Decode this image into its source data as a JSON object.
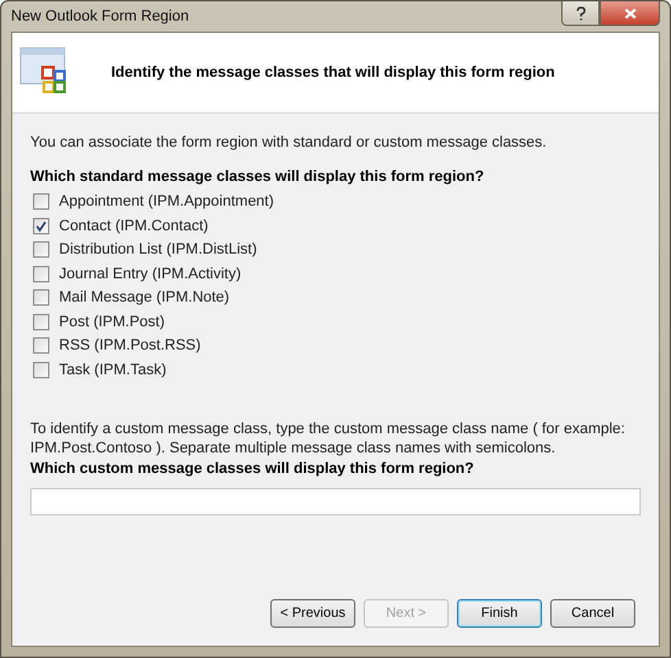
{
  "window": {
    "title": "New Outlook Form Region"
  },
  "header": {
    "title": "Identify the message classes that will display this form region"
  },
  "intro": "You can associate the form region with standard or custom message classes.",
  "standard": {
    "heading": "Which standard message classes will display this form region?",
    "options": [
      {
        "label": "Appointment (IPM.Appointment)",
        "checked": false
      },
      {
        "label": "Contact (IPM.Contact)",
        "checked": true
      },
      {
        "label": "Distribution List (IPM.DistList)",
        "checked": false
      },
      {
        "label": "Journal Entry (IPM.Activity)",
        "checked": false
      },
      {
        "label": "Mail Message (IPM.Note)",
        "checked": false
      },
      {
        "label": "Post (IPM.Post)",
        "checked": false
      },
      {
        "label": "RSS (IPM.Post.RSS)",
        "checked": false
      },
      {
        "label": "Task (IPM.Task)",
        "checked": false
      }
    ]
  },
  "custom": {
    "description": "To identify a custom message class, type the custom message class name ( for example: IPM.Post.Contoso ). Separate multiple message class names with semicolons.",
    "heading": "Which custom message classes will display this form region?"
  },
  "buttons": [
    {
      "label": "< Previous",
      "disabled": false,
      "default": false
    },
    {
      "label": "Next >",
      "disabled": true,
      "default": false
    },
    {
      "label": "Finish",
      "disabled": false,
      "default": true
    },
    {
      "label": "Cancel",
      "disabled": false,
      "default": false
    }
  ]
}
